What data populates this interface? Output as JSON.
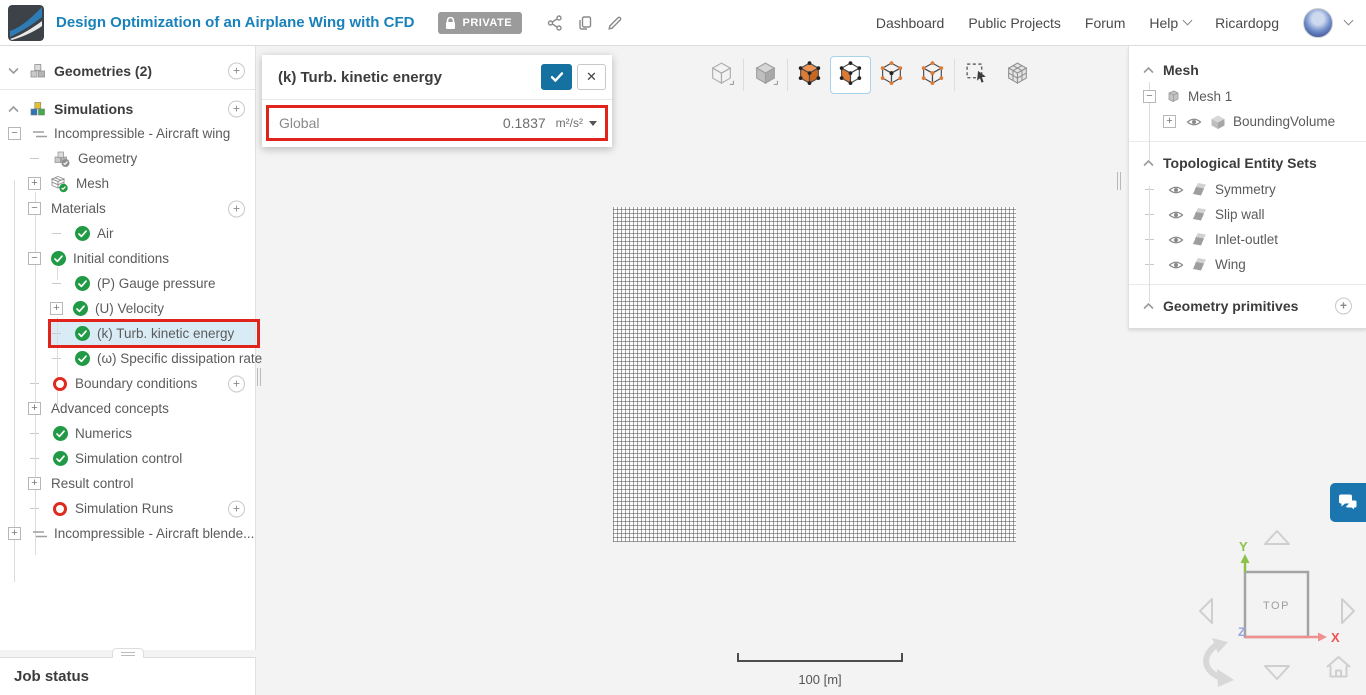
{
  "header": {
    "title": "Design Optimization of an Airplane Wing with CFD",
    "private_badge": "PRIVATE",
    "nav": [
      "Dashboard",
      "Public Projects",
      "Forum",
      "Help"
    ],
    "user": "Ricardopg",
    "action_icons": [
      "share-icon",
      "copy-icon",
      "edit-icon"
    ]
  },
  "sim_tree": {
    "rows": [
      {
        "label": "Geometries (2)",
        "level": 0,
        "expander": "chevron-down",
        "icon": "cubes-gray",
        "add": true,
        "bold": true,
        "separator_after": true
      },
      {
        "label": "Simulations",
        "level": 0,
        "expander": "chevron-up",
        "icon": "cubes-color",
        "add": true,
        "bold": true
      },
      {
        "label": "Incompressible - Aircraft wing",
        "level": 1,
        "expander": "minus",
        "icon": "sim-lines"
      },
      {
        "label": "Geometry",
        "level": 2,
        "expander": "dash",
        "icon": "geometry-cube"
      },
      {
        "label": "Mesh",
        "level": 2,
        "expander": "plus",
        "icon": "mesh-cube"
      },
      {
        "label": "Materials",
        "level": 2,
        "expander": "minus",
        "add": true
      },
      {
        "label": "Air",
        "level": 3,
        "expander": "dash",
        "status": "ok"
      },
      {
        "label": "Initial conditions",
        "level": 2,
        "expander": "minus",
        "status": "ok"
      },
      {
        "label": "(P) Gauge pressure",
        "level": 3,
        "expander": "dash",
        "status": "ok"
      },
      {
        "label": "(U) Velocity",
        "level": 3,
        "expander": "plus",
        "status": "ok"
      },
      {
        "label": "(k) Turb. kinetic energy",
        "level": 3,
        "expander": "dash",
        "status": "ok",
        "highlighted": true
      },
      {
        "label": "(ω) Specific dissipation rate",
        "level": 3,
        "expander": "dash",
        "status": "ok"
      },
      {
        "label": "Boundary conditions",
        "level": 2,
        "expander": "dash",
        "status": "err",
        "add": true
      },
      {
        "label": "Advanced concepts",
        "level": 2,
        "expander": "plus"
      },
      {
        "label": "Numerics",
        "level": 2,
        "expander": "dash",
        "status": "ok"
      },
      {
        "label": "Simulation control",
        "level": 2,
        "expander": "dash",
        "status": "ok"
      },
      {
        "label": "Result control",
        "level": 2,
        "expander": "plus"
      },
      {
        "label": "Simulation Runs",
        "level": 2,
        "expander": "dash",
        "status": "err",
        "add": true
      },
      {
        "label": "Incompressible - Aircraft blende...",
        "level": 1,
        "expander": "plus",
        "icon": "sim-lines"
      }
    ]
  },
  "panel": {
    "title": "(k) Turb. kinetic energy",
    "confirm_icon": "check-icon",
    "close_icon": "close-icon",
    "field_label": "Global",
    "field_value": "0.1837",
    "field_unit": "m²/s²"
  },
  "toolbar": {
    "tools": [
      {
        "name": "view-wireframe"
      },
      {
        "sep": true
      },
      {
        "name": "view-solid"
      },
      {
        "sep": true
      },
      {
        "name": "select-volume"
      },
      {
        "name": "select-face",
        "active": true
      },
      {
        "name": "select-vertex"
      },
      {
        "name": "select-edge"
      },
      {
        "sep": true
      },
      {
        "name": "box-select"
      },
      {
        "name": "select-mesh"
      }
    ]
  },
  "scene_tree": {
    "sections": [
      {
        "header": "Mesh",
        "items": [
          {
            "label": "Mesh 1",
            "level": 1,
            "expander": "minus",
            "icon": "mesh-part"
          },
          {
            "label": "BoundingVolume",
            "level": 2,
            "expander": "plus",
            "eye": true,
            "icon": "cube-solid"
          }
        ]
      },
      {
        "header": "Topological Entity Sets",
        "items": [
          {
            "label": "Symmetry",
            "level": 1,
            "expander": "dash",
            "eye": true,
            "icon": "face-set"
          },
          {
            "label": "Slip wall",
            "level": 1,
            "expander": "dash",
            "eye": true,
            "icon": "face-set"
          },
          {
            "label": "Inlet-outlet",
            "level": 1,
            "expander": "dash",
            "eye": true,
            "icon": "face-set"
          },
          {
            "label": "Wing",
            "level": 1,
            "expander": "dash",
            "eye": true,
            "icon": "face-set"
          }
        ]
      },
      {
        "header": "Geometry primitives",
        "add": true,
        "items": []
      }
    ]
  },
  "viewport": {
    "scale_label": "100 [m]",
    "nav_cube_face": "TOP",
    "axis_x": "X",
    "axis_y": "Y",
    "axis_z": "Z",
    "chat_icon": "chat-bubbles-icon"
  },
  "job_status": {
    "label": "Job status"
  },
  "colors": {
    "accent_blue": "#15719f",
    "title_blue": "#1a82bb",
    "highlight_red": "#e1241b",
    "ok_green": "#219a46",
    "err_red": "#df2b1f",
    "select_orange": "#dd7a33",
    "chat_blue": "#1b76b0"
  }
}
